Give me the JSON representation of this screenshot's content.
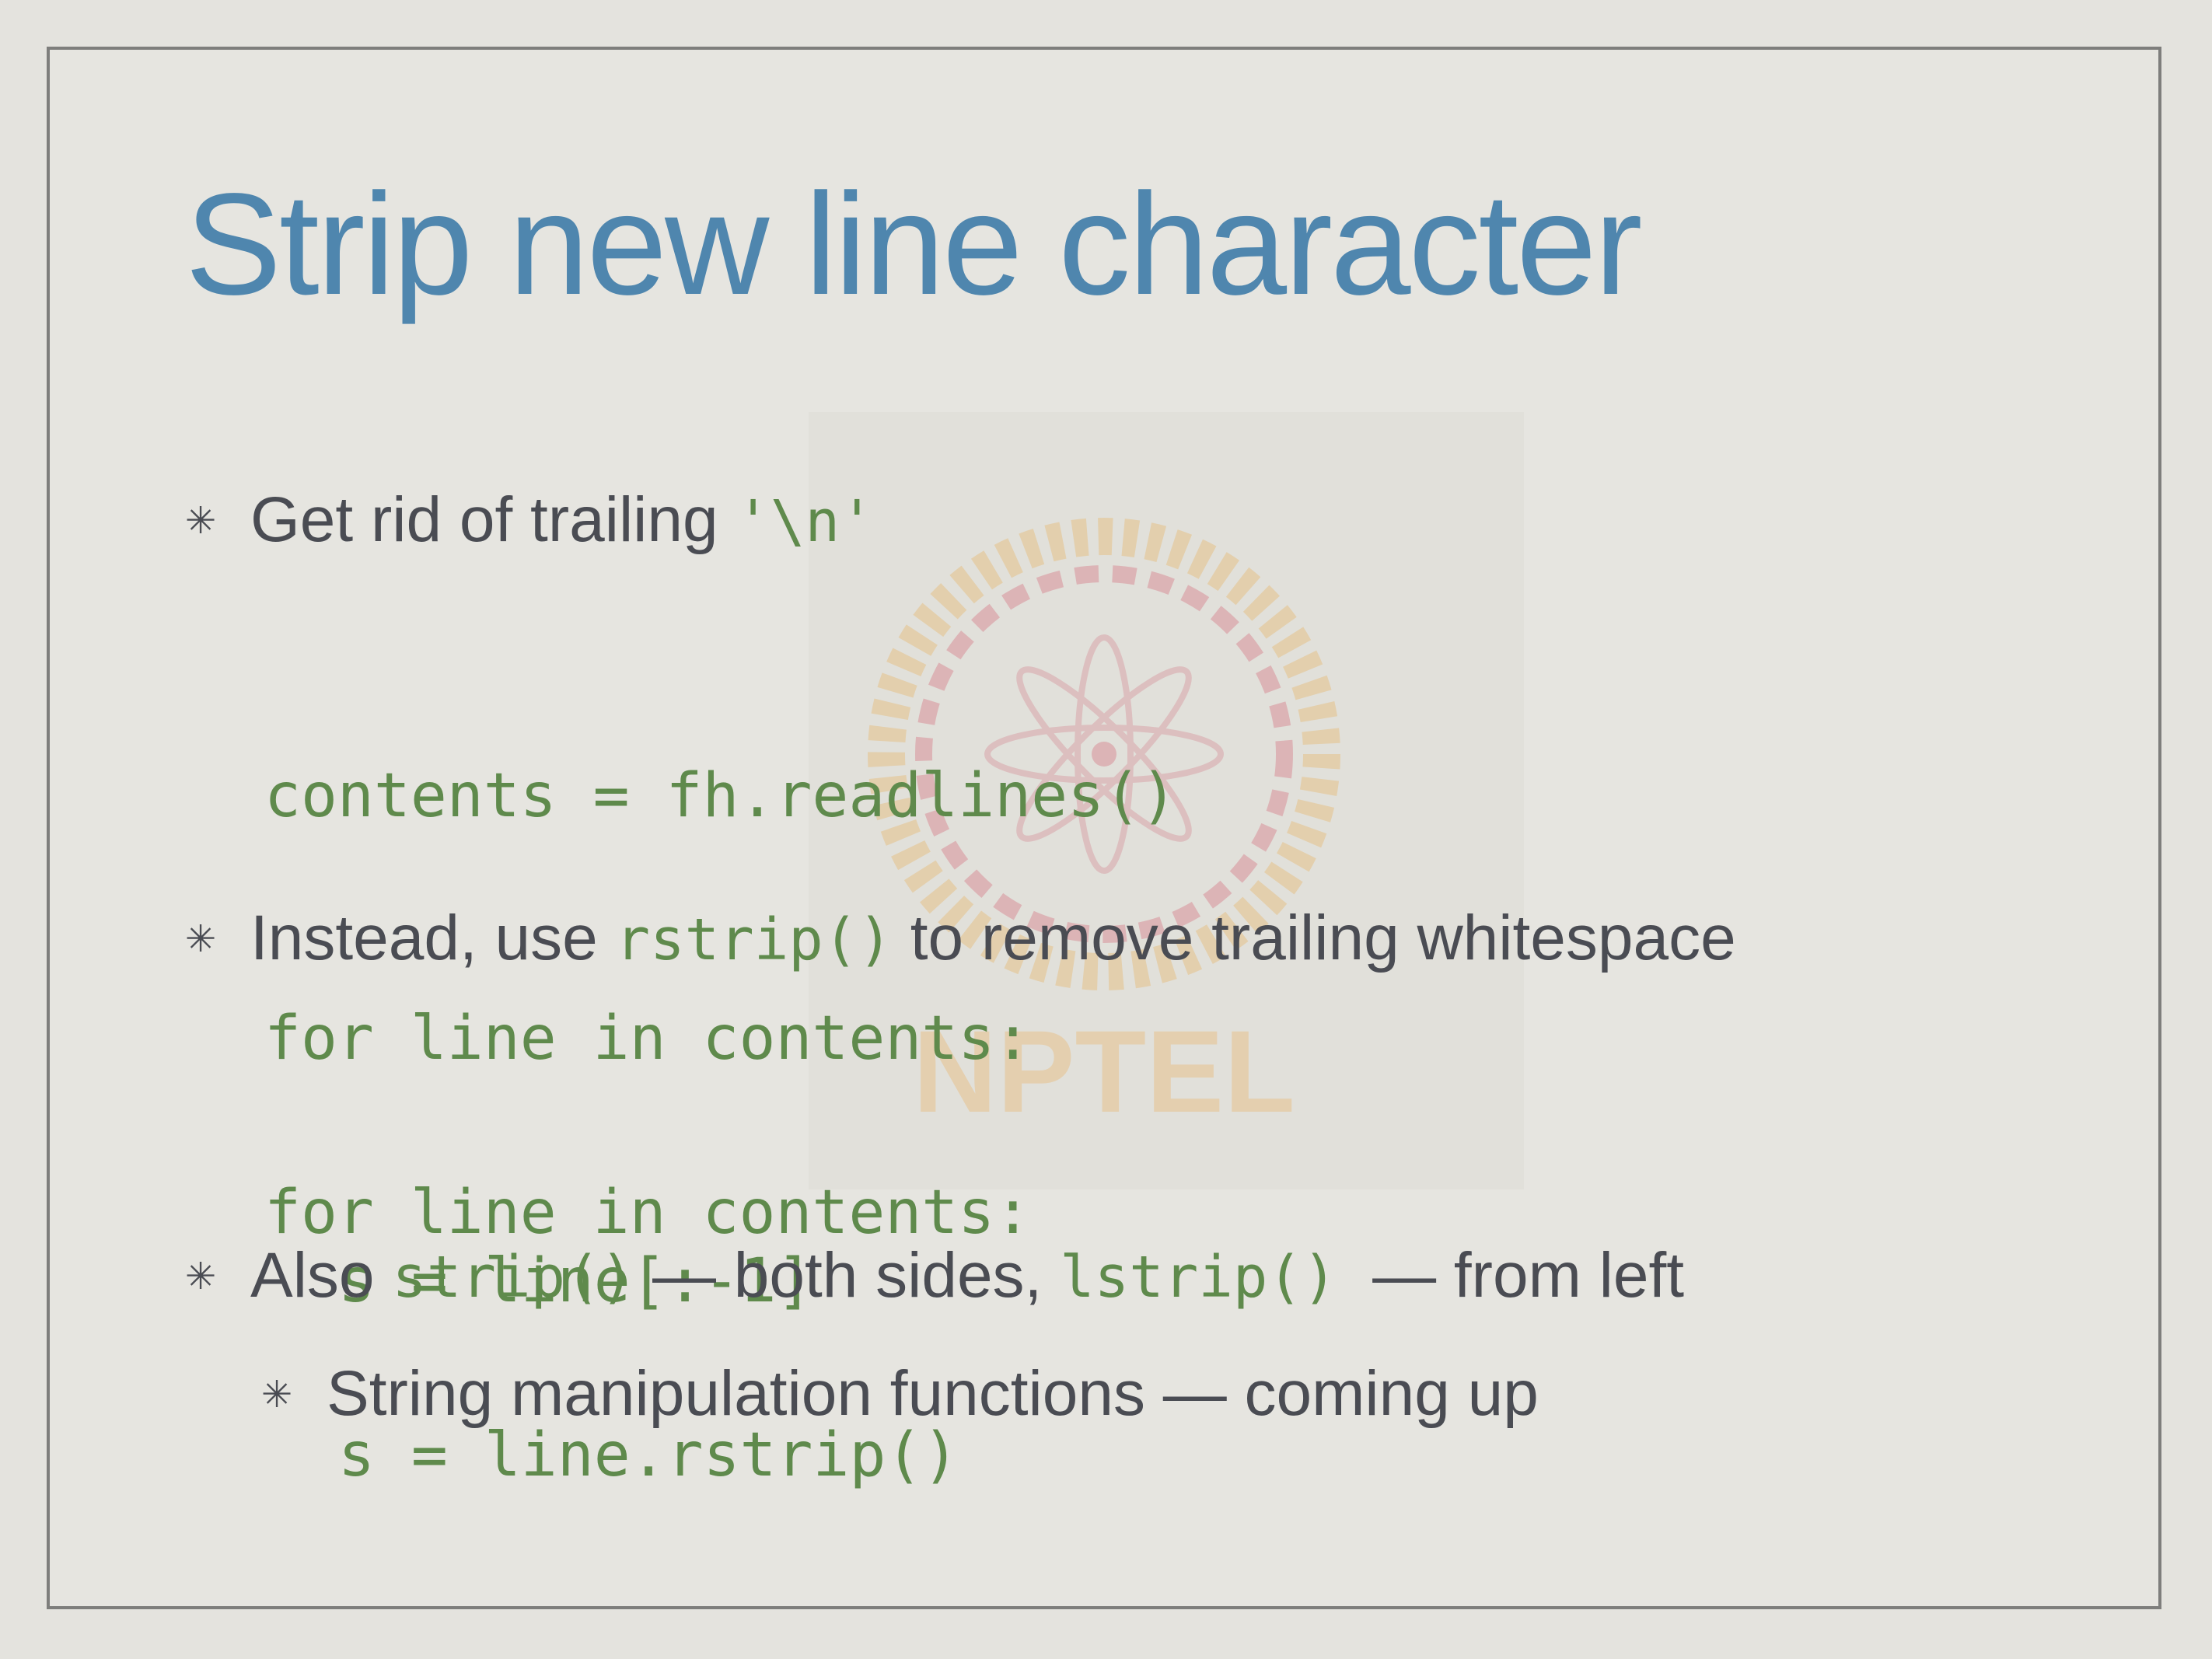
{
  "slide": {
    "title": "Strip new line character",
    "watermark_text": "NPTEL",
    "bullets": [
      {
        "text": "Get rid of trailing ",
        "code": "'\\n'"
      },
      {
        "text_before": "Instead, use ",
        "code": "rstrip()",
        "text_after": " to remove trailing whitespace"
      },
      {
        "text_before": "Also ",
        "code1": "strip()",
        "text_mid": " — both sides, ",
        "code2": "lstrip()",
        "text_after": "  — from left"
      }
    ],
    "sub_bullet": "String manipulation functions — coming up",
    "code_block_1": [
      "contents = fh.readlines()",
      "for line in contents:",
      "s = line[:-1]"
    ],
    "code_block_2": [
      "for line in contents:",
      "s = line.rstrip()"
    ]
  },
  "colors": {
    "title": "#4f86ae",
    "body_text": "#4a4c53",
    "code": "#5f8a4c",
    "background": "#e6e5e0",
    "frame": "#7e7e7c"
  },
  "icons": {
    "bullet": "asterisk-bullet-icon",
    "watermark": "nptel-logo-icon"
  }
}
